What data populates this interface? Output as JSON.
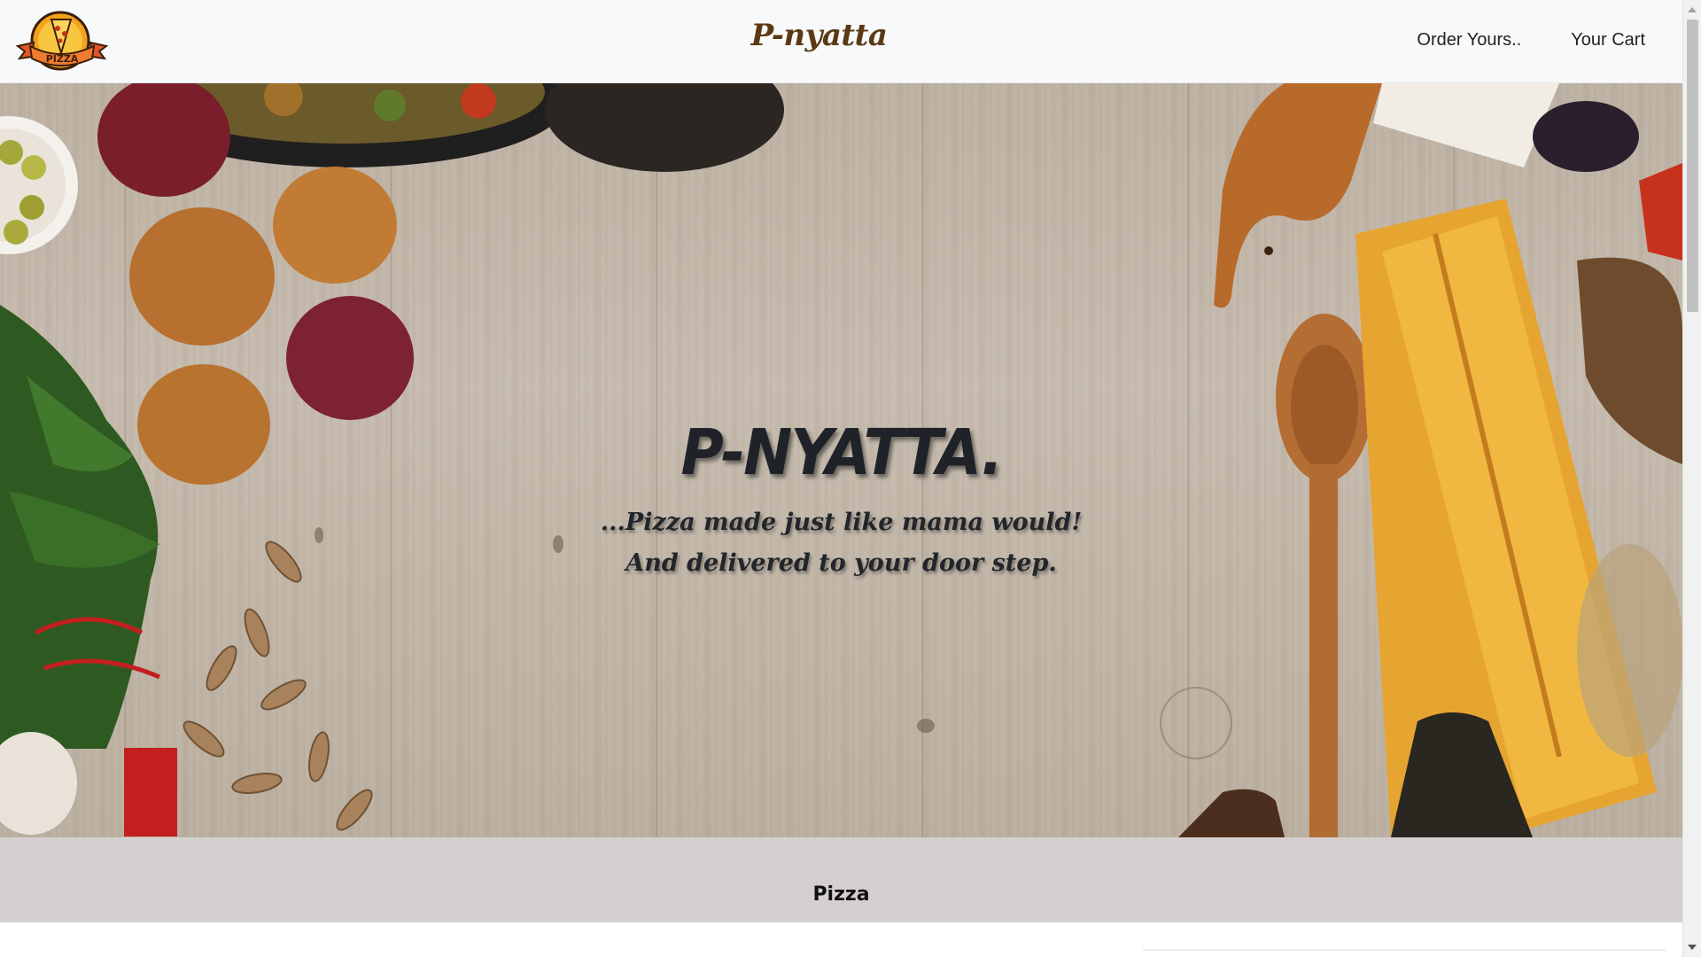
{
  "navbar": {
    "brand": "P-nyatta",
    "logo_icon": "pizza-logo-icon",
    "logo_text": "PIZZA",
    "links": [
      {
        "label": "Order Yours.."
      },
      {
        "label": "Your Cart"
      }
    ]
  },
  "hero": {
    "title": "P-NYATTA.",
    "tagline_line1": "...Pizza made just like mama would!",
    "tagline_line2": "And delivered to your door step."
  },
  "section": {
    "title": "Pizza"
  },
  "colors": {
    "navbar_bg": "#f8f9fa",
    "brand_color": "#5a3a14",
    "hero_text": "#1f2329",
    "section_bg": "#d5d0cf"
  }
}
